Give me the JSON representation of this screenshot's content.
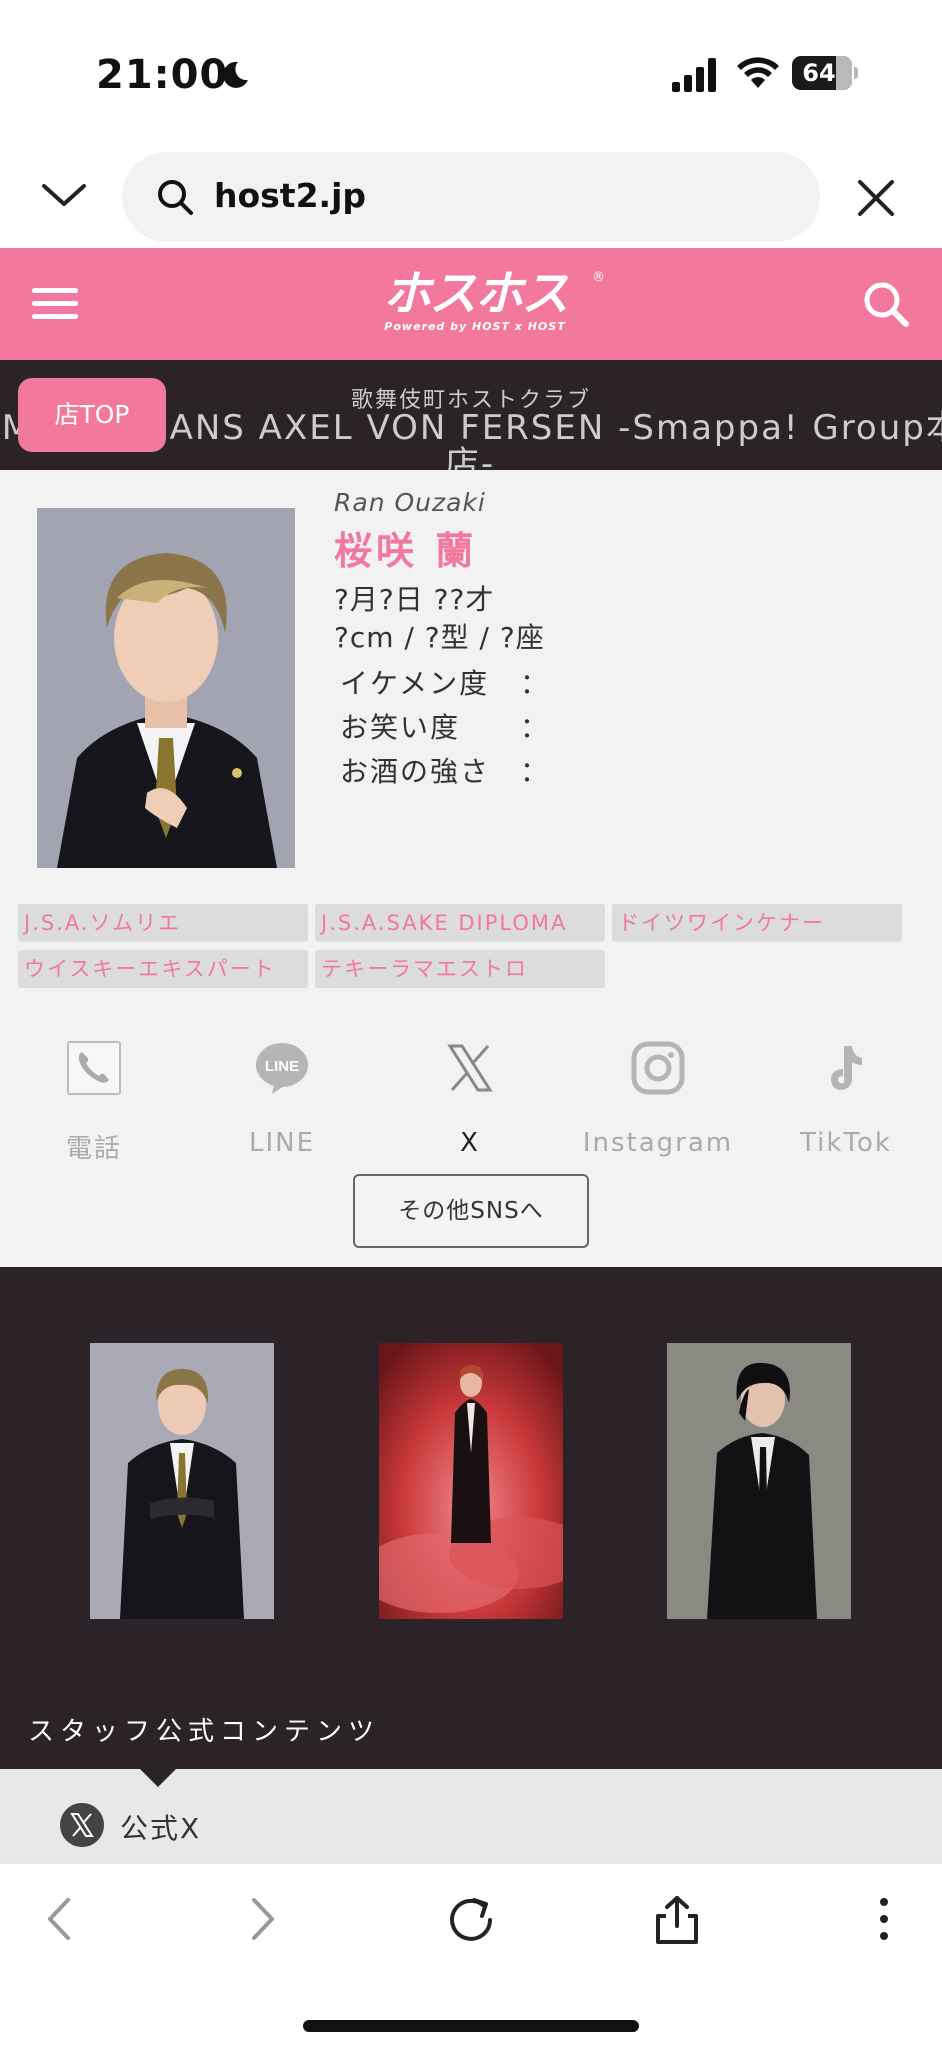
{
  "status_bar": {
    "time": "21:00",
    "battery": "64"
  },
  "browser": {
    "url": "host2.jp"
  },
  "site": {
    "logo_main": "ホスホス",
    "logo_sub": "Powered by HOST x HOST",
    "logo_reg": "®"
  },
  "club": {
    "label": "歌舞伎町ホストクラブ",
    "name": "SMAPPA!HANS AXEL VON FERSEN -Smappa! Group本店-",
    "shop_top": "店TOP"
  },
  "profile": {
    "romaji": "Ran Ouzaki",
    "name": "桜咲 蘭",
    "birth": "?月?日 ??才",
    "body": "?cm / ?型 / ?座",
    "stats": [
      {
        "label": "イケメン度",
        "sep": "："
      },
      {
        "label": "お笑い度",
        "sep": "："
      },
      {
        "label": "お酒の強さ",
        "sep": "："
      }
    ],
    "tags": [
      "J.S.A.ソムリエ",
      "J.S.A.SAKE DIPLOMA",
      "ドイツワインケナー",
      "ウイスキーエキスパート",
      "テキーラマエストロ"
    ]
  },
  "sns": {
    "items": [
      {
        "label": "電話",
        "icon": "phone-icon"
      },
      {
        "label": "LINE",
        "icon": "line-icon"
      },
      {
        "label": "X",
        "icon": "x-icon"
      },
      {
        "label": "Instagram",
        "icon": "instagram-icon"
      },
      {
        "label": "TikTok",
        "icon": "tiktok-icon"
      }
    ],
    "other_button": "その他SNSへ"
  },
  "gallery": {
    "staff_title": "スタッフ公式コンテンツ"
  },
  "official": {
    "label": "公式X"
  },
  "colors": {
    "brand_pink": "#f2789e",
    "dark_bg": "#2b2327"
  }
}
